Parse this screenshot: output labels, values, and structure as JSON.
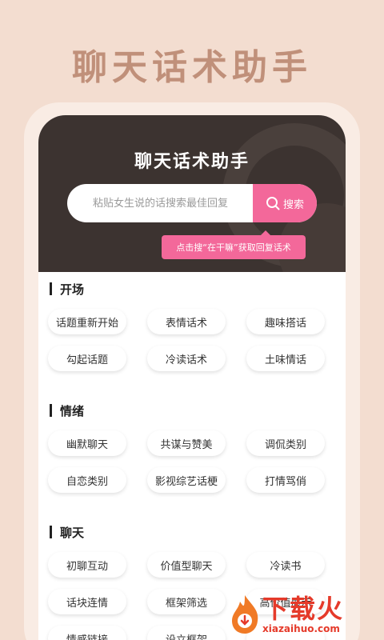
{
  "promo": {
    "title": "聊天话术助手"
  },
  "app": {
    "title": "聊天话术助手"
  },
  "search": {
    "placeholder": "粘贴女生说的话搜索最佳回复",
    "button_label": "搜索",
    "hint": "点击搜“在干嘛”获取回复话术"
  },
  "sections": [
    {
      "title": "开场",
      "items": [
        "话题重新开始",
        "表情话术",
        "趣味搭话",
        "勾起话题",
        "冷读话术",
        "土味情话"
      ]
    },
    {
      "title": "情绪",
      "items": [
        "幽默聊天",
        "共谋与赞美",
        "调侃类别",
        "自恋类别",
        "影视综艺话梗",
        "打情骂俏"
      ]
    },
    {
      "title": "聊天",
      "items": [
        "初聊互动",
        "价值型聊天",
        "冷读书",
        "话块连情",
        "框架筛选",
        "高价值展示",
        "情感链接",
        "设立框架",
        ""
      ]
    }
  ],
  "watermark": {
    "main": "下载火",
    "sub": "xiazaihuo.com"
  },
  "colors": {
    "accent": "#f3689a",
    "header_bg": "#3c3330",
    "page_bg": "#f3ddd0",
    "promo_text": "#c0907a"
  }
}
